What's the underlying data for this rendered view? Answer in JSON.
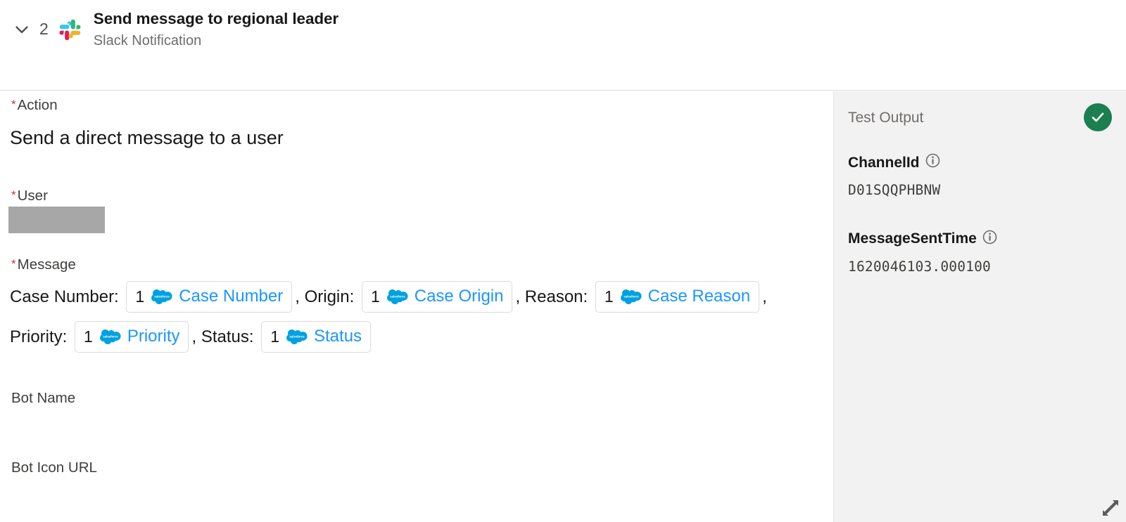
{
  "header": {
    "collapse_icon": "chevron-down-icon",
    "step_number": "2",
    "app_icon": "slack-logo-icon",
    "title": "Send message to regional leader",
    "subtitle": "Slack Notification"
  },
  "form": {
    "required_marker": "*",
    "action": {
      "label": "Action",
      "value": "Send a direct message to a user"
    },
    "user": {
      "label": "User",
      "value": "",
      "redacted": true
    },
    "message": {
      "label": "Message",
      "lines": [
        {
          "segments": [
            {
              "kind": "text",
              "text": "Case Number: "
            },
            {
              "kind": "pill",
              "index": "1",
              "icon": "salesforce-cloud-icon",
              "label": "Case Number"
            },
            {
              "kind": "text",
              "text": ", Origin: "
            },
            {
              "kind": "pill",
              "index": "1",
              "icon": "salesforce-cloud-icon",
              "label": "Case Origin"
            },
            {
              "kind": "text",
              "text": ", Reason: "
            },
            {
              "kind": "pill",
              "index": "1",
              "icon": "salesforce-cloud-icon",
              "label": "Case Reason"
            },
            {
              "kind": "text",
              "text": ","
            }
          ]
        },
        {
          "segments": [
            {
              "kind": "text",
              "text": "Priority: "
            },
            {
              "kind": "pill",
              "index": "1",
              "icon": "salesforce-cloud-icon",
              "label": "Priority"
            },
            {
              "kind": "text",
              "text": ", Status: "
            },
            {
              "kind": "pill",
              "index": "1",
              "icon": "salesforce-cloud-icon",
              "label": "Status"
            }
          ]
        }
      ]
    },
    "bot_name": {
      "label": "Bot Name",
      "value": ""
    },
    "bot_icon_url": {
      "label": "Bot Icon URL",
      "value": ""
    }
  },
  "test_output": {
    "title": "Test Output",
    "status_icon": "success-check-icon",
    "status_color": "#1b7f4f",
    "entries": [
      {
        "key": "ChannelId",
        "info_icon": "info-icon",
        "value": "D01SQQPHBNW"
      },
      {
        "key": "MessageSentTime",
        "info_icon": "info-icon",
        "value": "1620046103.000100"
      }
    ]
  },
  "footer": {
    "resize_icon": "resize-expand-icon"
  },
  "colors": {
    "required_star": "#c23934",
    "pill_label": "#1b96ff",
    "panel_bg": "#f3f2f2",
    "success": "#1b7f4f",
    "redacted": "#a7a7a7"
  }
}
